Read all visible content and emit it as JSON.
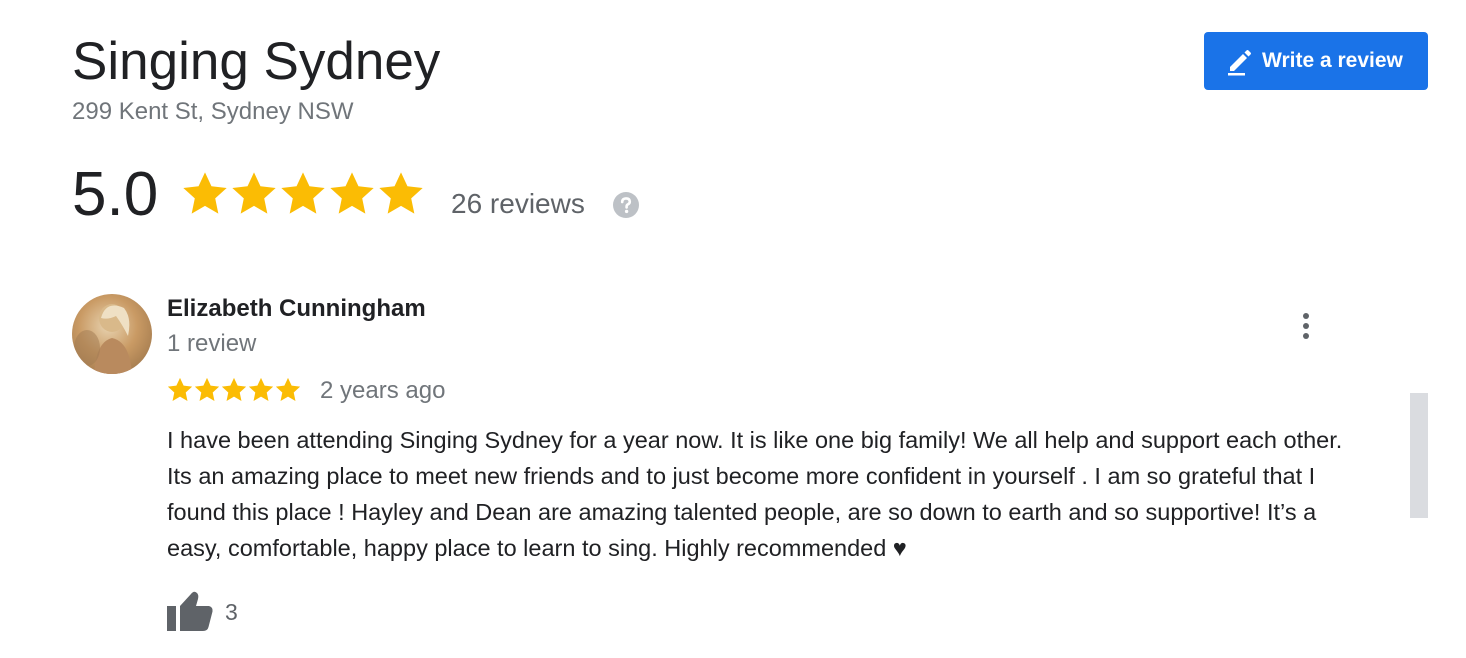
{
  "business": {
    "name": "Singing Sydney",
    "address": "299 Kent St, Sydney NSW",
    "rating": "5.0",
    "star_count": 5,
    "review_count": "26 reviews"
  },
  "actions": {
    "write_review_label": "Write a review"
  },
  "review": {
    "author": "Elizabeth Cunningham",
    "author_meta": "1 review",
    "stars": 5,
    "date": "2 years ago",
    "text": "I have been attending Singing Sydney for a year now. It is like one big family! We all help and support each other. Its an amazing place to meet new friends and to just become more confident in yourself . I am so grateful that I found this place ! Hayley and Dean are amazing talented people, are so down to earth and so supportive! It’s a easy, comfortable, happy place to learn to sing. Highly recommended ♥",
    "likes": "3"
  },
  "icons": {
    "write": "pencil-icon",
    "help": "help-circle-icon",
    "more": "more-vert-icon",
    "like": "thumbs-up-icon",
    "star": "star-icon"
  },
  "colors": {
    "star": "#fbbc04",
    "accent": "#1a73e8",
    "muted": "#70757a"
  }
}
